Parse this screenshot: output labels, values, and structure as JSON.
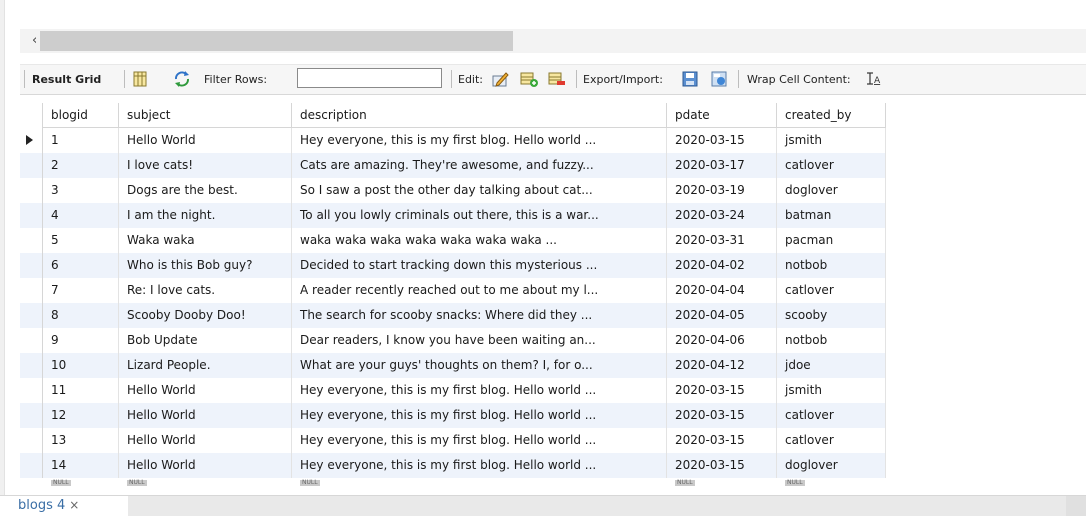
{
  "toolbar": {
    "result_grid": "Result Grid",
    "filter_rows": "Filter Rows:",
    "filter_value": "",
    "edit": "Edit:",
    "export_import": "Export/Import:",
    "wrap_cell": "Wrap Cell Content:",
    "icons": [
      "grid-layout-icon",
      "refresh-icon",
      "edit-cell-icon",
      "insert-row-icon",
      "delete-row-icon",
      "export-icon",
      "import-icon",
      "wrap-text-icon"
    ]
  },
  "grid": {
    "columns": [
      "blogid",
      "subject",
      "description",
      "pdate",
      "created_by"
    ],
    "rows": [
      [
        "1",
        "Hello World",
        "Hey everyone, this is my first blog. Hello world ...",
        "2020-03-15",
        "jsmith"
      ],
      [
        "2",
        "I love cats!",
        "Cats are amazing. They're awesome, and fuzzy...",
        "2020-03-17",
        "catlover"
      ],
      [
        "3",
        "Dogs are the best.",
        "So I saw a post the other day talking about cat...",
        "2020-03-19",
        "doglover"
      ],
      [
        "4",
        "I am the night.",
        "To all you lowly criminals out there, this is a war...",
        "2020-03-24",
        "batman"
      ],
      [
        "5",
        "Waka waka",
        "waka waka waka waka waka waka waka ...",
        "2020-03-31",
        "pacman"
      ],
      [
        "6",
        "Who is this Bob guy?",
        "Decided to start tracking down this mysterious ...",
        "2020-04-02",
        "notbob"
      ],
      [
        "7",
        "Re: I love cats.",
        "A reader recently reached out to me about my l...",
        "2020-04-04",
        "catlover"
      ],
      [
        "8",
        "Scooby Dooby Doo!",
        "The search for scooby snacks: Where did they ...",
        "2020-04-05",
        "scooby"
      ],
      [
        "9",
        "Bob Update",
        "Dear readers, I know you have been waiting an...",
        "2020-04-06",
        "notbob"
      ],
      [
        "10",
        "Lizard People.",
        "What are your guys' thoughts on them? I, for o...",
        "2020-04-12",
        "jdoe"
      ],
      [
        "11",
        "Hello World",
        "Hey everyone, this is my first blog. Hello world ...",
        "2020-03-15",
        "jsmith"
      ],
      [
        "12",
        "Hello World",
        "Hey everyone, this is my first blog. Hello world ...",
        "2020-03-15",
        "catlover"
      ],
      [
        "13",
        "Hello World",
        "Hey everyone, this is my first blog. Hello world ...",
        "2020-03-15",
        "catlover"
      ],
      [
        "14",
        "Hello World",
        "Hey everyone, this is my first blog. Hello world ...",
        "2020-03-15",
        "doglover"
      ]
    ],
    "null_label": "NULL"
  },
  "tabs": {
    "active": "blogs 4",
    "close": "×"
  },
  "colors": {
    "alt_row": "#eef3fb",
    "tab_text": "#3a6ea5"
  }
}
